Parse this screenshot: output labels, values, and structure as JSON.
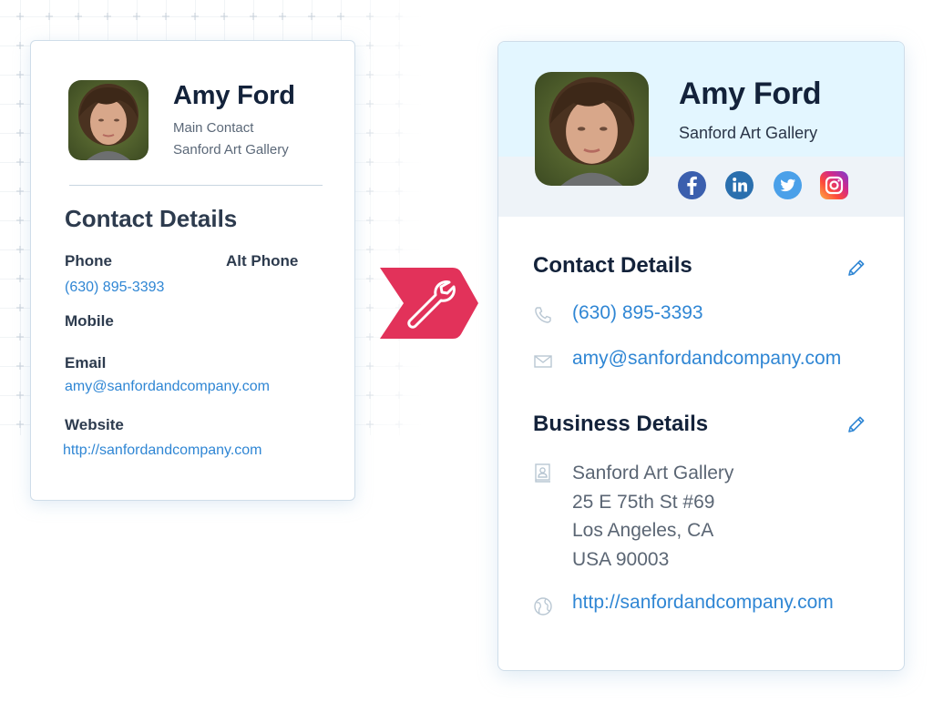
{
  "before_card": {
    "name": "Amy Ford",
    "role": "Main Contact",
    "company": "Sanford Art Gallery",
    "section_title": "Contact Details",
    "fields": {
      "phone_label": "Phone",
      "phone_value": "(630) 895-3393",
      "alt_phone_label": "Alt Phone",
      "mobile_label": "Mobile",
      "email_label": "Email",
      "email_value": "amy@sanfordandcompany.com",
      "website_label": "Website",
      "website_value": "http://sanfordandcompany.com"
    }
  },
  "transform_badge": {
    "icon": "wrench-icon",
    "color": "#e2325a"
  },
  "after_card": {
    "name": "Amy Ford",
    "company": "Sanford Art Gallery",
    "social": [
      {
        "name": "facebook",
        "icon": "facebook-icon",
        "glyph": "f"
      },
      {
        "name": "linkedin",
        "icon": "linkedin-icon",
        "glyph": "in"
      },
      {
        "name": "twitter",
        "icon": "twitter-icon"
      },
      {
        "name": "instagram",
        "icon": "instagram-icon"
      }
    ],
    "contact_section": {
      "title": "Contact Details",
      "edit_icon": "pencil-icon",
      "phone": "(630) 895-3393",
      "email": "amy@sanfordandcompany.com"
    },
    "business_section": {
      "title": "Business Details",
      "edit_icon": "pencil-icon",
      "address_lines": [
        "Sanford Art Gallery",
        "25 E 75th St #69",
        "Los Angeles, CA",
        "USA 90003"
      ],
      "website": "http://sanfordandcompany.com"
    }
  },
  "colors": {
    "link": "#2f86d4",
    "heading": "#13223a",
    "header_band": "#e3f6ff",
    "social_band": "#eef3f8",
    "accent": "#e2325a"
  }
}
